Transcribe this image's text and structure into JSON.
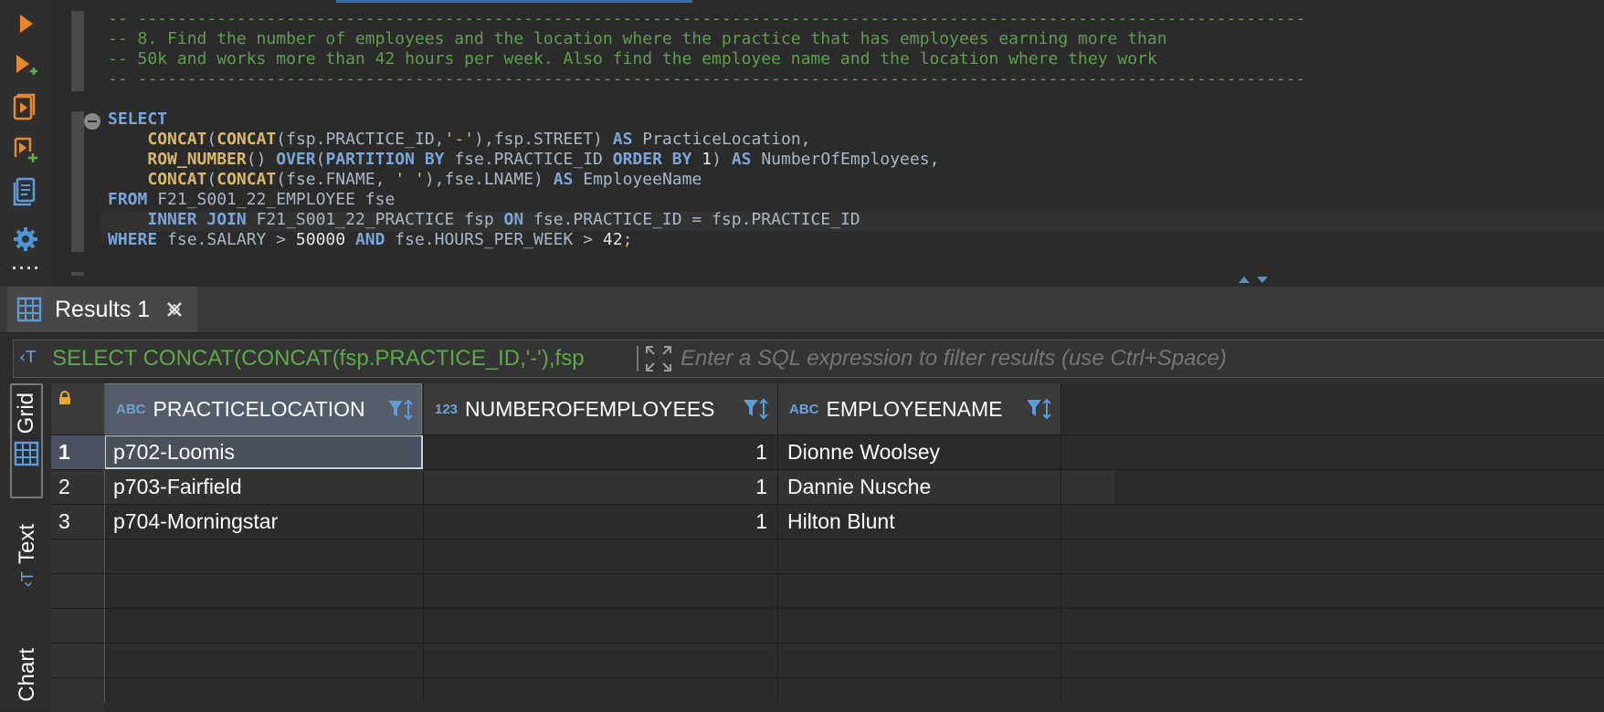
{
  "editor": {
    "code_lines": [
      "-- ----------------------------------------------------------------------------------------------------------------------",
      "-- 8. Find the number of employees and the location where the practice that has employees earning more than",
      "-- 50k and works more than 42 hours per week. Also find the employee name and the location where they work",
      "-- ----------------------------------------------------------------------------------------------------------------------"
    ]
  },
  "toolbar": {
    "icons": [
      "execute-icon",
      "execute-new-tab-icon",
      "execute-script-icon",
      "execute-script-new-tab-icon",
      "explain-plan-icon",
      "settings-icon",
      "more-icon"
    ]
  },
  "results": {
    "tab_label": "Results 1",
    "filter": {
      "query": "SELECT CONCAT(CONCAT(fsp.PRACTICE_ID,'-'),fsp",
      "placeholder": "Enter a SQL expression to filter results (use Ctrl+Space)"
    },
    "side_tabs": {
      "grid": "Grid",
      "text": "Text",
      "chart": "Chart"
    },
    "columns": [
      {
        "type": "ABC",
        "name": "PRACTICELOCATION"
      },
      {
        "type": "123",
        "name": "NUMBEROFEMPLOYEES"
      },
      {
        "type": "ABC",
        "name": "EMPLOYEENAME"
      }
    ],
    "rows": [
      {
        "num": "1",
        "practicelocation": "p702-Loomis",
        "numberofemployees": "1",
        "employeename": "Dionne Woolsey"
      },
      {
        "num": "2",
        "practicelocation": "p703-Fairfield",
        "numberofemployees": "1",
        "employeename": "Dannie Nusche"
      },
      {
        "num": "3",
        "practicelocation": "p704-Morningstar",
        "numberofemployees": "1",
        "employeename": "Hilton Blunt"
      }
    ]
  },
  "colors": {
    "comment": "#5f9e4f",
    "keyword": "#7aa6da",
    "function": "#d9b869",
    "accent": "#3d6ea3"
  }
}
